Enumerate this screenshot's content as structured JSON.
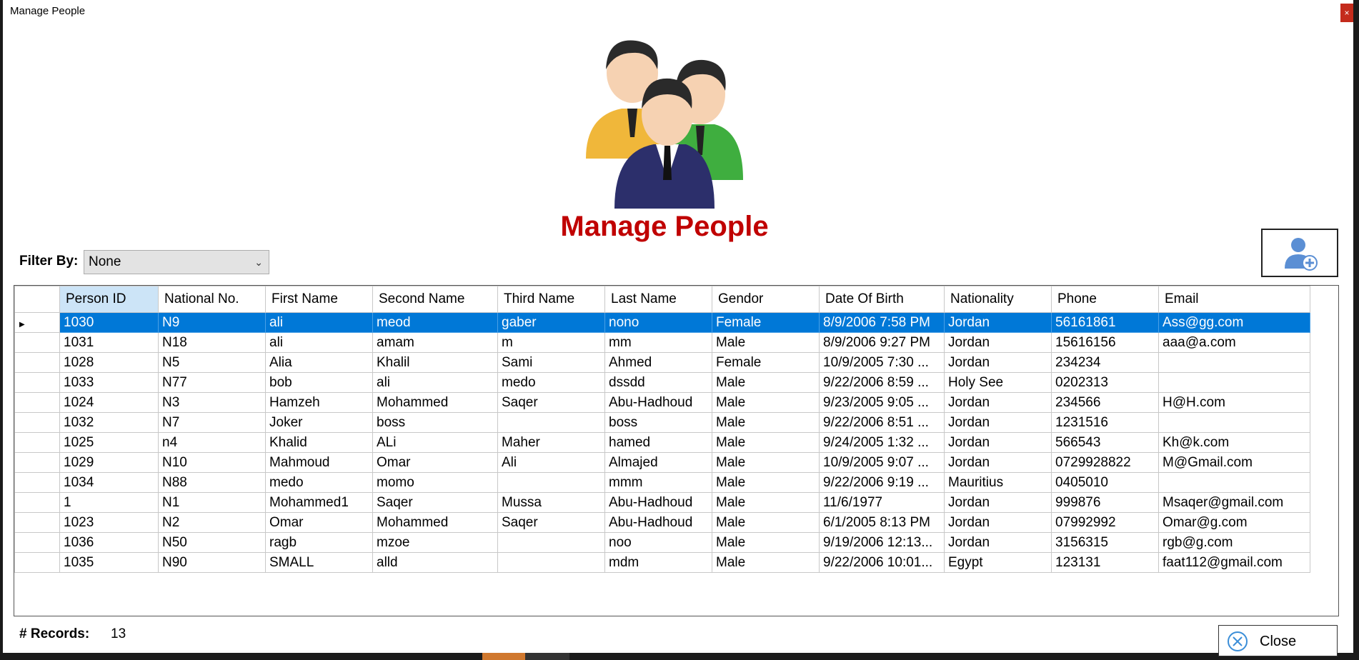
{
  "window": {
    "title": "Manage People",
    "close_glyph": "×"
  },
  "header": {
    "title": "Manage People",
    "logo_icon": "people-group-icon"
  },
  "filter": {
    "label": "Filter By:",
    "selected": "None"
  },
  "add_button": {
    "icon": "add-person-icon"
  },
  "table": {
    "columns": [
      "Person ID",
      "National No.",
      "First Name",
      "Second Name",
      "Third Name",
      "Last Name",
      "Gendor",
      "Date Of Birth",
      "Nationality",
      "Phone",
      "Email"
    ],
    "selected_row": 0,
    "rows": [
      [
        "1030",
        "N9",
        "ali",
        "meod",
        "gaber",
        "nono",
        "Female",
        "8/9/2006 7:58 PM",
        "Jordan",
        "56161861",
        "Ass@gg.com"
      ],
      [
        "1031",
        "N18",
        "ali",
        "amam",
        "m",
        "mm",
        "Male",
        "8/9/2006 9:27 PM",
        "Jordan",
        "15616156",
        "aaa@a.com"
      ],
      [
        "1028",
        "N5",
        "Alia",
        "Khalil",
        "Sami",
        "Ahmed",
        "Female",
        "10/9/2005 7:30 ...",
        "Jordan",
        "234234",
        ""
      ],
      [
        "1033",
        "N77",
        "bob",
        "ali",
        "medo",
        "dssdd",
        "Male",
        "9/22/2006 8:59 ...",
        "Holy See",
        "0202313",
        ""
      ],
      [
        "1024",
        "N3",
        "Hamzeh",
        "Mohammed",
        "Saqer",
        "Abu-Hadhoud",
        "Male",
        "9/23/2005 9:05 ...",
        "Jordan",
        "234566",
        "H@H.com"
      ],
      [
        "1032",
        "N7",
        "Joker",
        "boss",
        "",
        "boss",
        "Male",
        "9/22/2006 8:51 ...",
        "Jordan",
        "1231516",
        ""
      ],
      [
        "1025",
        "n4",
        "Khalid",
        "ALi",
        "Maher",
        "hamed",
        "Male",
        "9/24/2005 1:32 ...",
        "Jordan",
        "566543",
        "Kh@k.com"
      ],
      [
        "1029",
        "N10",
        "Mahmoud",
        "Omar",
        "Ali",
        "Almajed",
        "Male",
        "10/9/2005 9:07 ...",
        "Jordan",
        "0729928822",
        "M@Gmail.com"
      ],
      [
        "1034",
        "N88",
        "medo",
        "momo",
        "",
        "mmm",
        "Male",
        "9/22/2006 9:19 ...",
        "Mauritius",
        "0405010",
        ""
      ],
      [
        "1",
        "N1",
        "Mohammed1",
        "Saqer",
        "Mussa",
        "Abu-Hadhoud",
        "Male",
        "11/6/1977",
        "Jordan",
        "999876",
        "Msaqer@gmail.com"
      ],
      [
        "1023",
        "N2",
        "Omar",
        "Mohammed",
        "Saqer",
        "Abu-Hadhoud",
        "Male",
        "6/1/2005 8:13 PM",
        "Jordan",
        "07992992",
        "Omar@g.com"
      ],
      [
        "1036",
        "N50",
        "ragb",
        "mzoe",
        "",
        "noo",
        "Male",
        "9/19/2006 12:13...",
        "Jordan",
        "3156315",
        "rgb@g.com"
      ],
      [
        "1035",
        "N90",
        "SMALL",
        "alld",
        "",
        "mdm",
        "Male",
        "9/22/2006 10:01...",
        "Egypt",
        "123131",
        "faat112@gmail.com"
      ]
    ]
  },
  "footer": {
    "records_label": "# Records:",
    "records_value": "13",
    "close_label": "Close"
  }
}
